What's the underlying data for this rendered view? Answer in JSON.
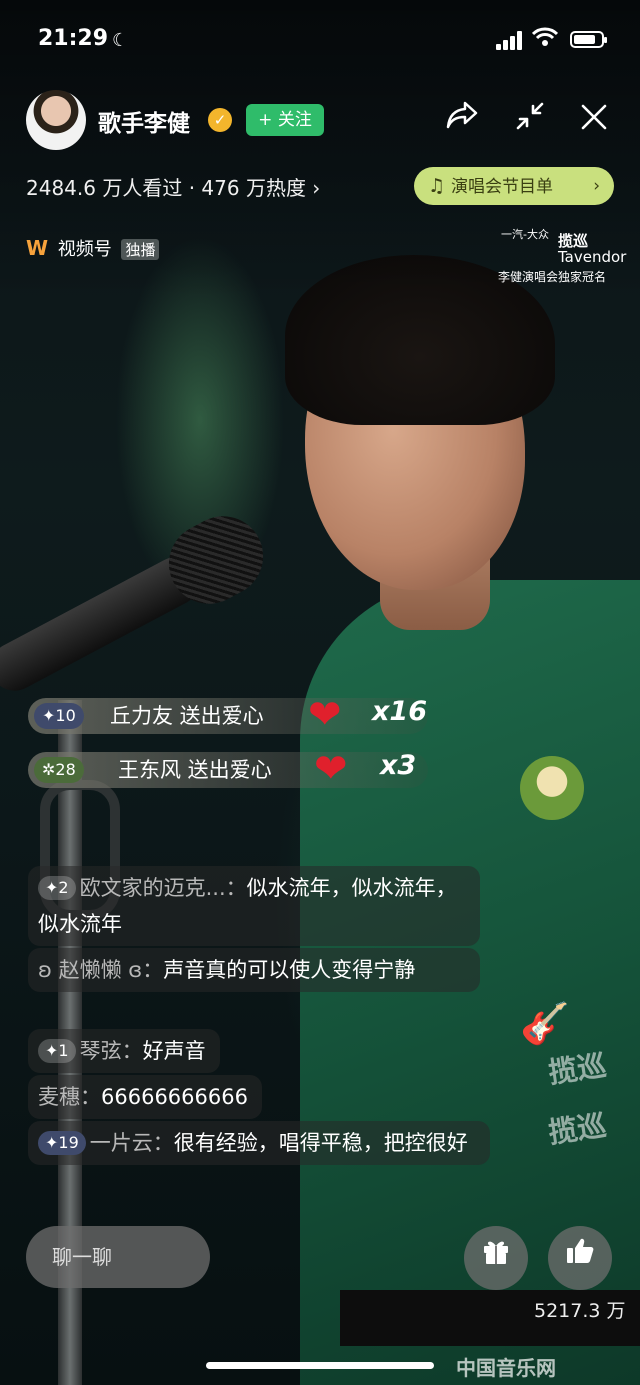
{
  "status_bar": {
    "time": "21:29",
    "moon_icon": "☾",
    "wifi_icon": "wifi-icon",
    "battery_level": 0.8
  },
  "header": {
    "host_name": "歌手李健",
    "verified_icon": "✓",
    "follow_label": "+ 关注",
    "share_icon": "↱",
    "minimize_icon": "↙↗",
    "close_icon": "✕"
  },
  "stats": {
    "text": "2484.6 万人看过 · 476 万热度 ›"
  },
  "playlist": {
    "note_icon": "♫",
    "label": "演唱会节目单",
    "chevron": "›"
  },
  "channel": {
    "logo": "W",
    "name": "视频号",
    "tag": "独播"
  },
  "sponsor": {
    "brand_mark": "一汽-大众",
    "brand_cn": "揽巡",
    "brand_en": "Tavendor",
    "tagline": "李健演唱会独家冠名"
  },
  "gifts": [
    {
      "level": "✦10",
      "message": "丘力友 送出爱心",
      "heart": "❤",
      "count": "x16"
    },
    {
      "level": "✲28",
      "message": "王东风 送出爱心",
      "heart": "❤",
      "count": "x3"
    }
  ],
  "comments": [
    {
      "level": "✦2",
      "nick": "欧文家的迈克...：",
      "text": "似水流年，似水流年，似水流年"
    },
    {
      "level": "",
      "nick": "ʚ 赵懒懒 ɞ：",
      "text": "声音真的可以使人变得宁静"
    },
    {
      "level": "✦1",
      "nick": "琴弦：",
      "text": "好声音"
    },
    {
      "level": "",
      "nick": "麦穗：",
      "text": "66666666666"
    },
    {
      "level": "✦19",
      "nick": "一片云：",
      "text": "很有经验，唱得平稳，把控很好"
    }
  ],
  "bottom": {
    "chat_placeholder": "聊一聊",
    "gift_icon": "🎁",
    "like_icon": "👍",
    "like_count": "5217.3 万"
  },
  "watermarks": {
    "first": "揽巡",
    "second": "揽巡",
    "guitar_icon": "🎸"
  },
  "site_mark": "中国音乐网"
}
